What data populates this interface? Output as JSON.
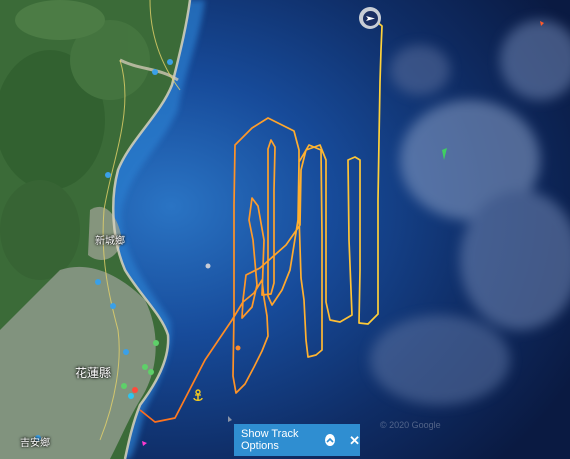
{
  "map": {
    "labels": {
      "xincheng": "新城鄉",
      "hualien": "花蓮縣",
      "jian": "吉安鄉"
    },
    "copyright": "© 2020 Google"
  },
  "track_options": {
    "label": "Show Track Options",
    "close": "✕"
  },
  "colors": {
    "sea_deep": "#0d1f4a",
    "sea_shallow": "#1f62b0",
    "land": "#3d6e3a",
    "track_start": "#ff6a1a",
    "track_end": "#ffd23a",
    "panel": "#2f8ed1"
  },
  "icons": {
    "vessel": "vessel-position-icon",
    "anchor": "anchor-icon",
    "chevron": "chevron-up-icon",
    "close": "close-icon"
  }
}
